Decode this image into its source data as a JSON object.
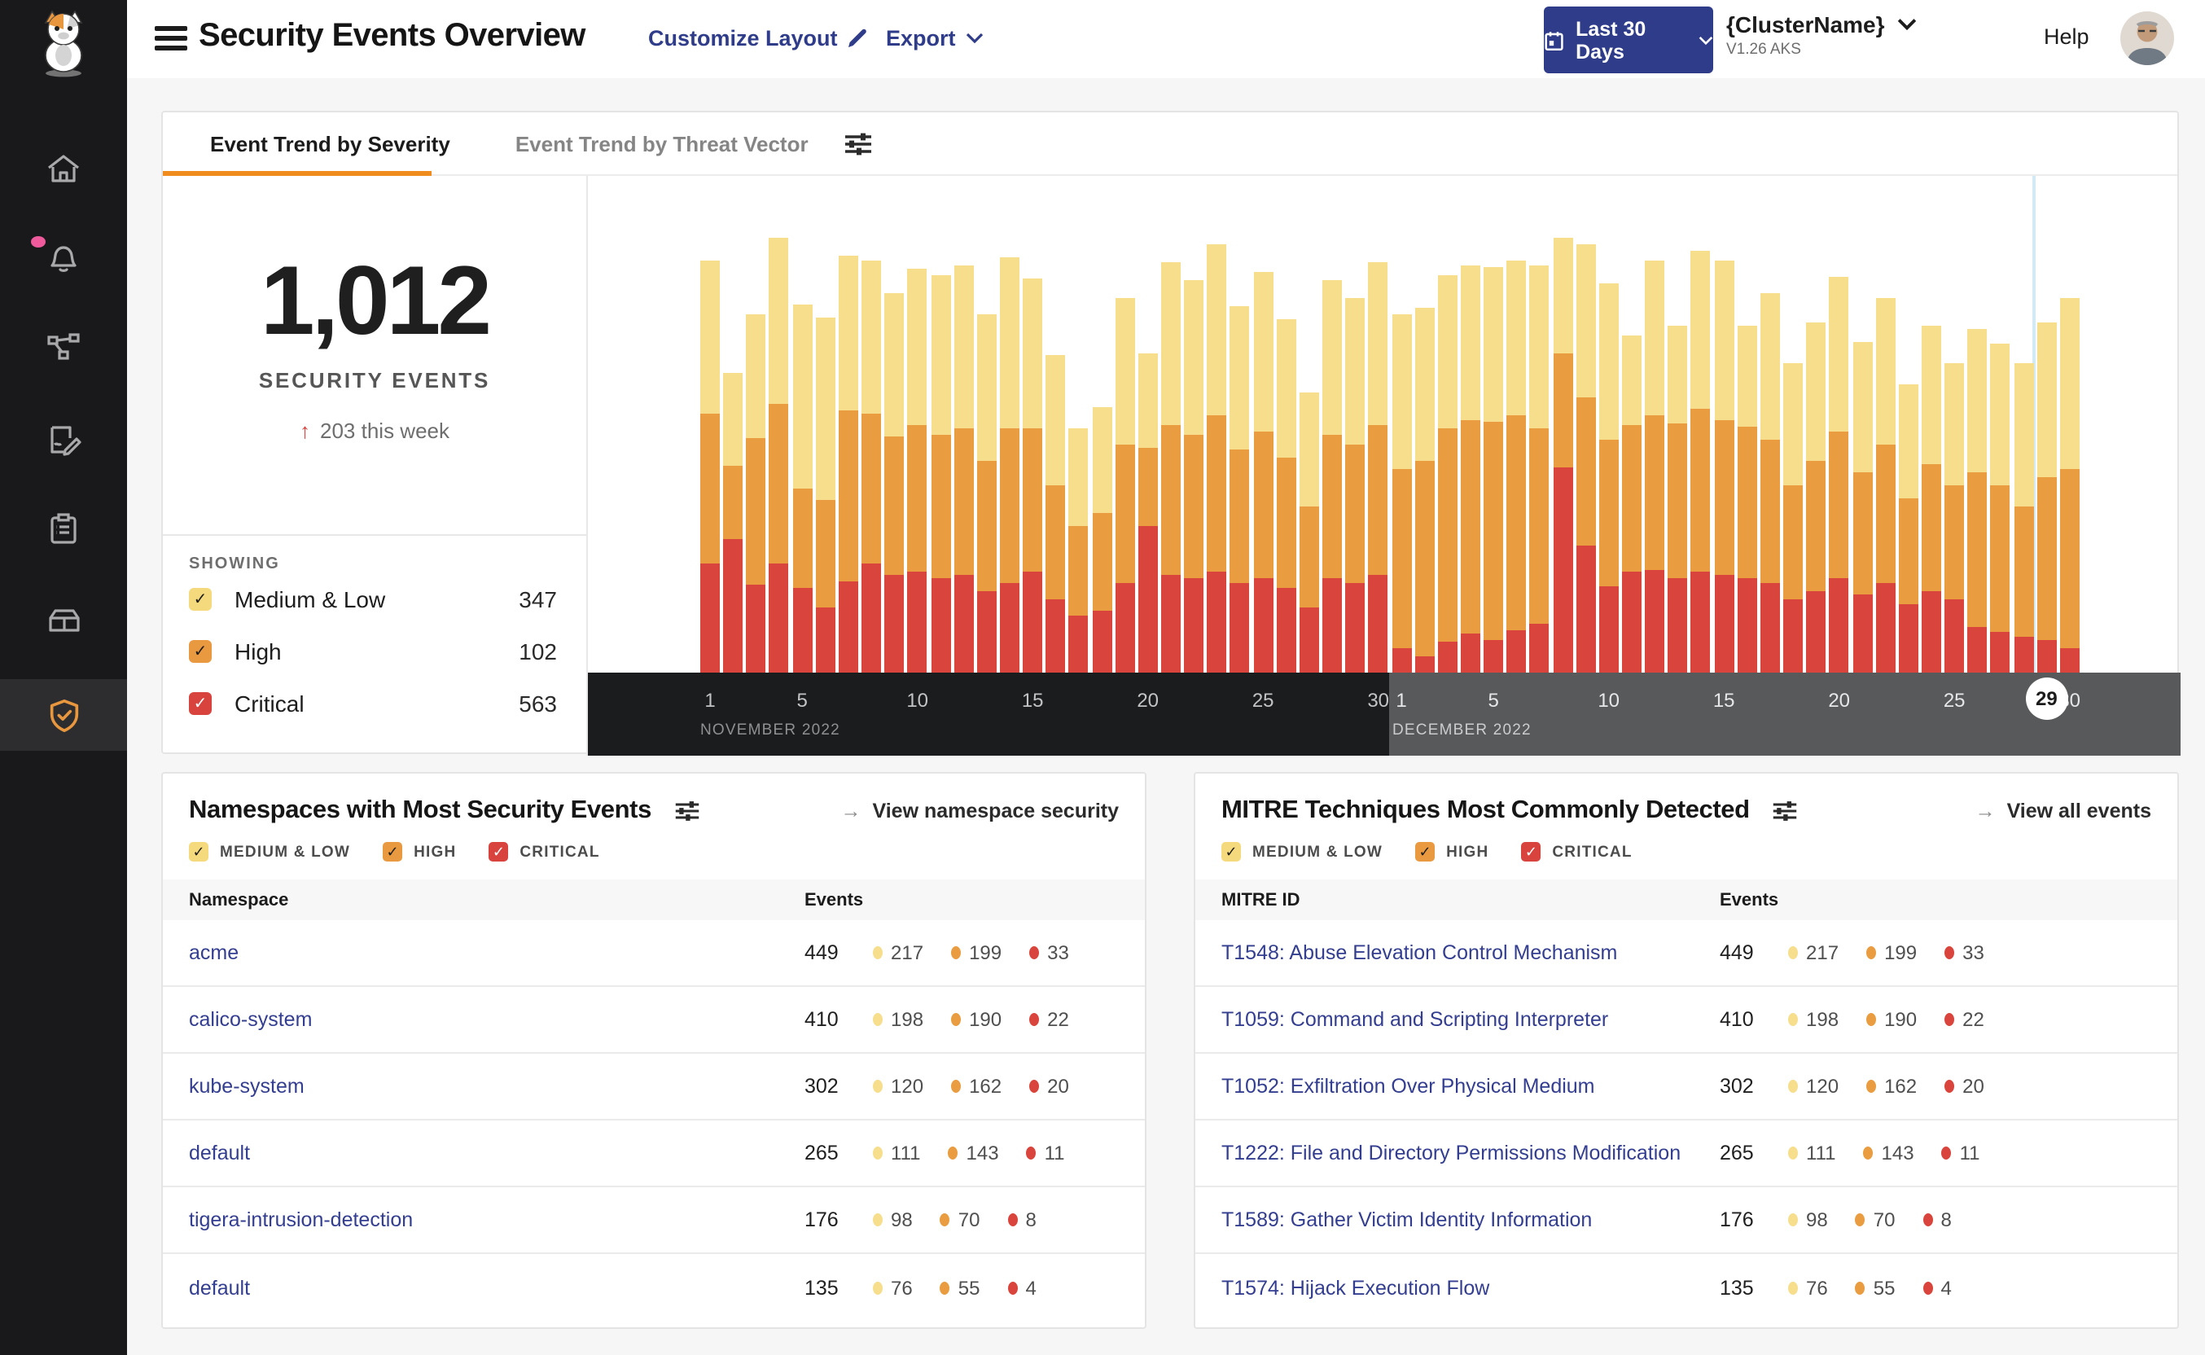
{
  "header": {
    "title": "Security Events Overview",
    "customize_layout": "Customize Layout",
    "export_label": "Export",
    "date_range": "Last 30 Days",
    "cluster_name": "{ClusterName}",
    "cluster_version": "V1.26 AKS",
    "help": "Help"
  },
  "sidebar": {
    "icons": [
      "calico-cat-logo",
      "home",
      "notifications-bell",
      "service-graph",
      "policies",
      "compliance-clipboard",
      "image-assurance-box",
      "threat-defense-shield"
    ],
    "active_item": "threat-defense-shield"
  },
  "tabs": {
    "severity": "Event Trend by Severity",
    "threat_vector": "Event Trend by Threat Vector"
  },
  "summary": {
    "total": "1,012",
    "events_label": "SECURITY EVENTS",
    "delta": "203 this week",
    "showing_label": "SHOWING",
    "filters": [
      {
        "label": "Medium & Low",
        "count": "347",
        "color": "#f5da7d",
        "check": "dark"
      },
      {
        "label": "High",
        "count": "102",
        "color": "#e9993f",
        "check": "dark"
      },
      {
        "label": "Critical",
        "count": "563",
        "color": "#d8433e",
        "check": "light"
      }
    ]
  },
  "severity_filters": [
    {
      "label": "MEDIUM & LOW",
      "color": "#f5da7d",
      "check": "dark"
    },
    {
      "label": "HIGH",
      "color": "#e9993f",
      "check": "dark"
    },
    {
      "label": "CRITICAL",
      "color": "#d8433e",
      "check": "light"
    }
  ],
  "chart_data": {
    "type": "bar",
    "stacked": true,
    "x": {
      "months": [
        {
          "label": "NOVEMBER 2022",
          "days": 30,
          "ticks": [
            1,
            5,
            10,
            15,
            20,
            25,
            30
          ]
        },
        {
          "label": "DECEMBER 2022",
          "days": 30,
          "ticks": [
            1,
            5,
            10,
            15,
            20,
            25,
            30
          ]
        }
      ],
      "selected_day": "29",
      "selected_index": 58
    },
    "series": [
      {
        "name": "Medium & Low",
        "color": "#f6de8c",
        "values": [
          94,
          57,
          76,
          102,
          113,
          112,
          95,
          94,
          88,
          96,
          98,
          100,
          90,
          105,
          92,
          80,
          60,
          65,
          90,
          58,
          100,
          95,
          105,
          88,
          98,
          85,
          70,
          95,
          90,
          100,
          95,
          94,
          94,
          95,
          95,
          95,
          100,
          71,
          94,
          96,
          55,
          95,
          60,
          97,
          98,
          62,
          90,
          75,
          85,
          95,
          80,
          90,
          70,
          85,
          75,
          88,
          87,
          88,
          95,
          105
        ]
      },
      {
        "name": "High",
        "color": "#e99c40",
        "values": [
          92,
          45,
          90,
          98,
          61,
          66,
          105,
          92,
          85,
          90,
          88,
          90,
          80,
          95,
          88,
          70,
          55,
          60,
          85,
          48,
          92,
          88,
          96,
          82,
          90,
          80,
          62,
          88,
          85,
          92,
          110,
          120,
          131,
          131,
          134,
          132,
          120,
          70,
          91,
          90,
          90,
          95,
          95,
          100,
          95,
          93,
          88,
          70,
          80,
          90,
          75,
          85,
          65,
          78,
          70,
          95,
          90,
          80,
          100,
          110
        ]
      },
      {
        "name": "Critical",
        "color": "#d9453c",
        "values": [
          67,
          82,
          54,
          67,
          52,
          40,
          56,
          67,
          60,
          62,
          58,
          60,
          50,
          55,
          62,
          45,
          35,
          38,
          55,
          90,
          60,
          58,
          62,
          55,
          58,
          52,
          40,
          58,
          55,
          60,
          15,
          10,
          19,
          24,
          20,
          26,
          30,
          126,
          78,
          53,
          62,
          63,
          58,
          62,
          60,
          58,
          55,
          45,
          50,
          58,
          48,
          55,
          42,
          50,
          45,
          28,
          25,
          22,
          20,
          15
        ]
      }
    ]
  },
  "namespaces_card": {
    "title": "Namespaces with Most Security Events",
    "link": "View namespace security",
    "col_name": "Namespace",
    "col_events": "Events",
    "rows": [
      {
        "name": "acme",
        "total": "449",
        "medium": "217",
        "high": "199",
        "critical": "33"
      },
      {
        "name": "calico-system",
        "total": "410",
        "medium": "198",
        "high": "190",
        "critical": "22"
      },
      {
        "name": "kube-system",
        "total": "302",
        "medium": "120",
        "high": "162",
        "critical": "20"
      },
      {
        "name": "default",
        "total": "265",
        "medium": "111",
        "high": "143",
        "critical": "11"
      },
      {
        "name": "tigera-intrusion-detection",
        "total": "176",
        "medium": "98",
        "high": "70",
        "critical": "8"
      },
      {
        "name": "default",
        "total": "135",
        "medium": "76",
        "high": "55",
        "critical": "4"
      }
    ]
  },
  "mitre_card": {
    "title": "MITRE Techniques Most Commonly Detected",
    "link": "View all events",
    "col_name": "MITRE ID",
    "col_events": "Events",
    "rows": [
      {
        "name": "T1548: Abuse Elevation Control Mechanism",
        "total": "449",
        "medium": "217",
        "high": "199",
        "critical": "33"
      },
      {
        "name": "T1059: Command and Scripting Interpreter",
        "total": "410",
        "medium": "198",
        "high": "190",
        "critical": "22"
      },
      {
        "name": "T1052: Exfiltration Over Physical Medium",
        "total": "302",
        "medium": "120",
        "high": "162",
        "critical": "20"
      },
      {
        "name": "T1222: File and Directory Permissions Modification",
        "total": "265",
        "medium": "111",
        "high": "143",
        "critical": "11"
      },
      {
        "name": "T1589: Gather Victim Identity Information",
        "total": "176",
        "medium": "98",
        "high": "70",
        "critical": "8"
      },
      {
        "name": "T1574: Hijack Execution Flow",
        "total": "135",
        "medium": "76",
        "high": "55",
        "critical": "4"
      }
    ]
  },
  "colors": {
    "medium": "#f6de8c",
    "high": "#e99c40",
    "critical": "#d9453c",
    "accent_orange": "#f08c1e",
    "link_blue": "#333e90",
    "button_indigo": "#2f3c8a",
    "band_november": "#1a1c1e",
    "band_december": "#58595b",
    "notification_pink": "#ee5a9c",
    "today_line": "#d2e9f6"
  }
}
